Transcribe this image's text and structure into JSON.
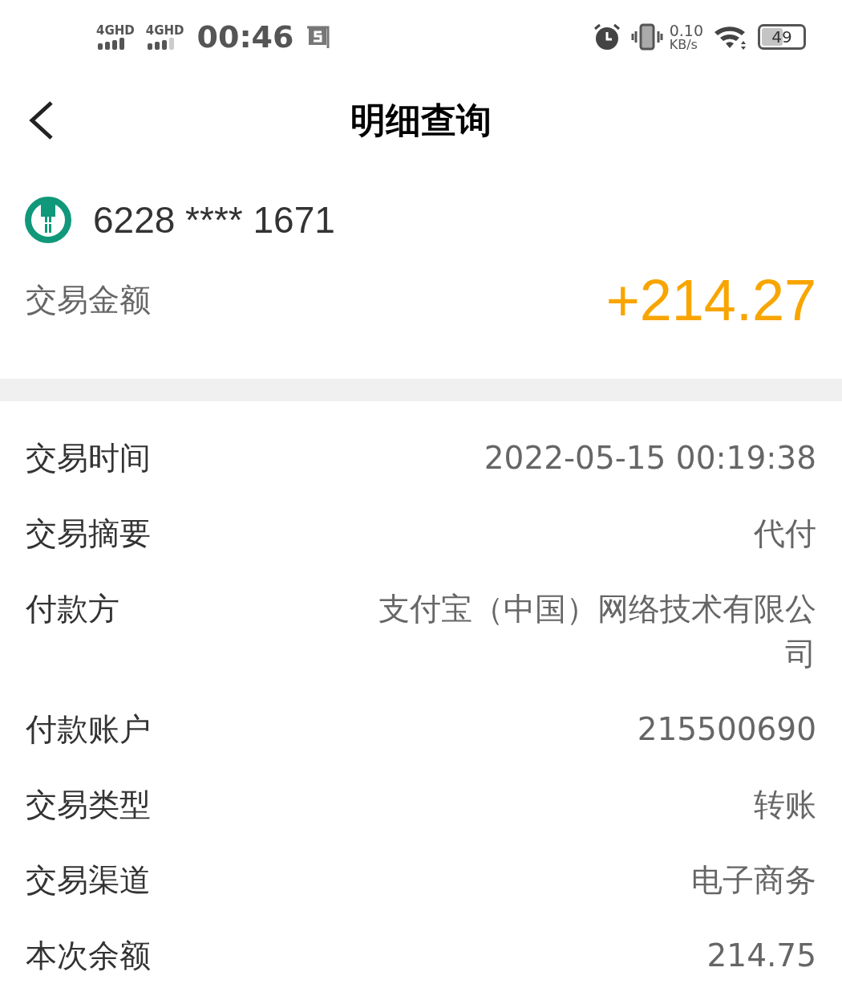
{
  "status_bar": {
    "network_1": "4GHD",
    "network_2": "4GHD",
    "time": "00:46",
    "speed_value": "0.10",
    "speed_unit": "KB/s",
    "battery": "49"
  },
  "header": {
    "title": "明细查询"
  },
  "card": {
    "number": "6228 **** 1671",
    "amount_label": "交易金额",
    "amount": "+214.27"
  },
  "details": [
    {
      "label": "交易时间",
      "value": "2022-05-15 00:19:38"
    },
    {
      "label": "交易摘要",
      "value": "代付"
    },
    {
      "label": "付款方",
      "value": "支付宝（中国）网络技术有限公司"
    },
    {
      "label": "付款账户",
      "value": "215500690"
    },
    {
      "label": "交易类型",
      "value": "转账"
    },
    {
      "label": "交易渠道",
      "value": "电子商务"
    },
    {
      "label": "本次余额",
      "value": "214.75"
    }
  ]
}
